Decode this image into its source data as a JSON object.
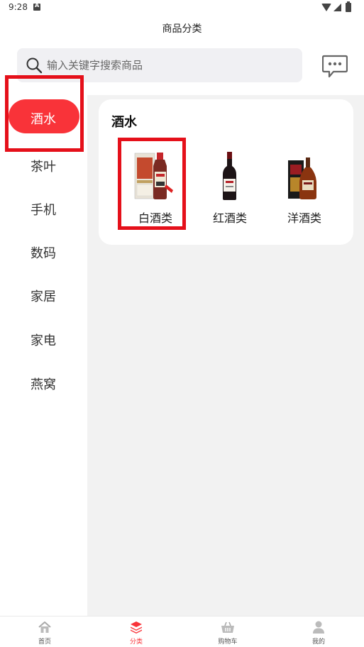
{
  "status_bar": {
    "time": "9:28"
  },
  "header": {
    "title": "商品分类"
  },
  "search": {
    "placeholder": "输入关键字搜索商品"
  },
  "sidebar": {
    "items": [
      {
        "label": "酒水",
        "active": true
      },
      {
        "label": "茶叶"
      },
      {
        "label": "手机"
      },
      {
        "label": "数码"
      },
      {
        "label": "家居"
      },
      {
        "label": "家电"
      },
      {
        "label": "燕窝"
      }
    ]
  },
  "category": {
    "title": "酒水",
    "products": [
      {
        "label": "白酒类",
        "icon": "baijiu-bottle-image"
      },
      {
        "label": "红酒类",
        "icon": "red-wine-bottle-image"
      },
      {
        "label": "洋酒类",
        "icon": "cognac-bottle-image"
      }
    ]
  },
  "bottom_nav": {
    "items": [
      {
        "label": "首页",
        "icon": "home-icon"
      },
      {
        "label": "分类",
        "icon": "layers-icon",
        "active": true
      },
      {
        "label": "购物车",
        "icon": "basket-icon"
      },
      {
        "label": "我的",
        "icon": "user-icon"
      }
    ]
  },
  "colors": {
    "accent": "#f93339",
    "highlight_box": "#e5101a",
    "content_bg": "#f2f2f2"
  }
}
